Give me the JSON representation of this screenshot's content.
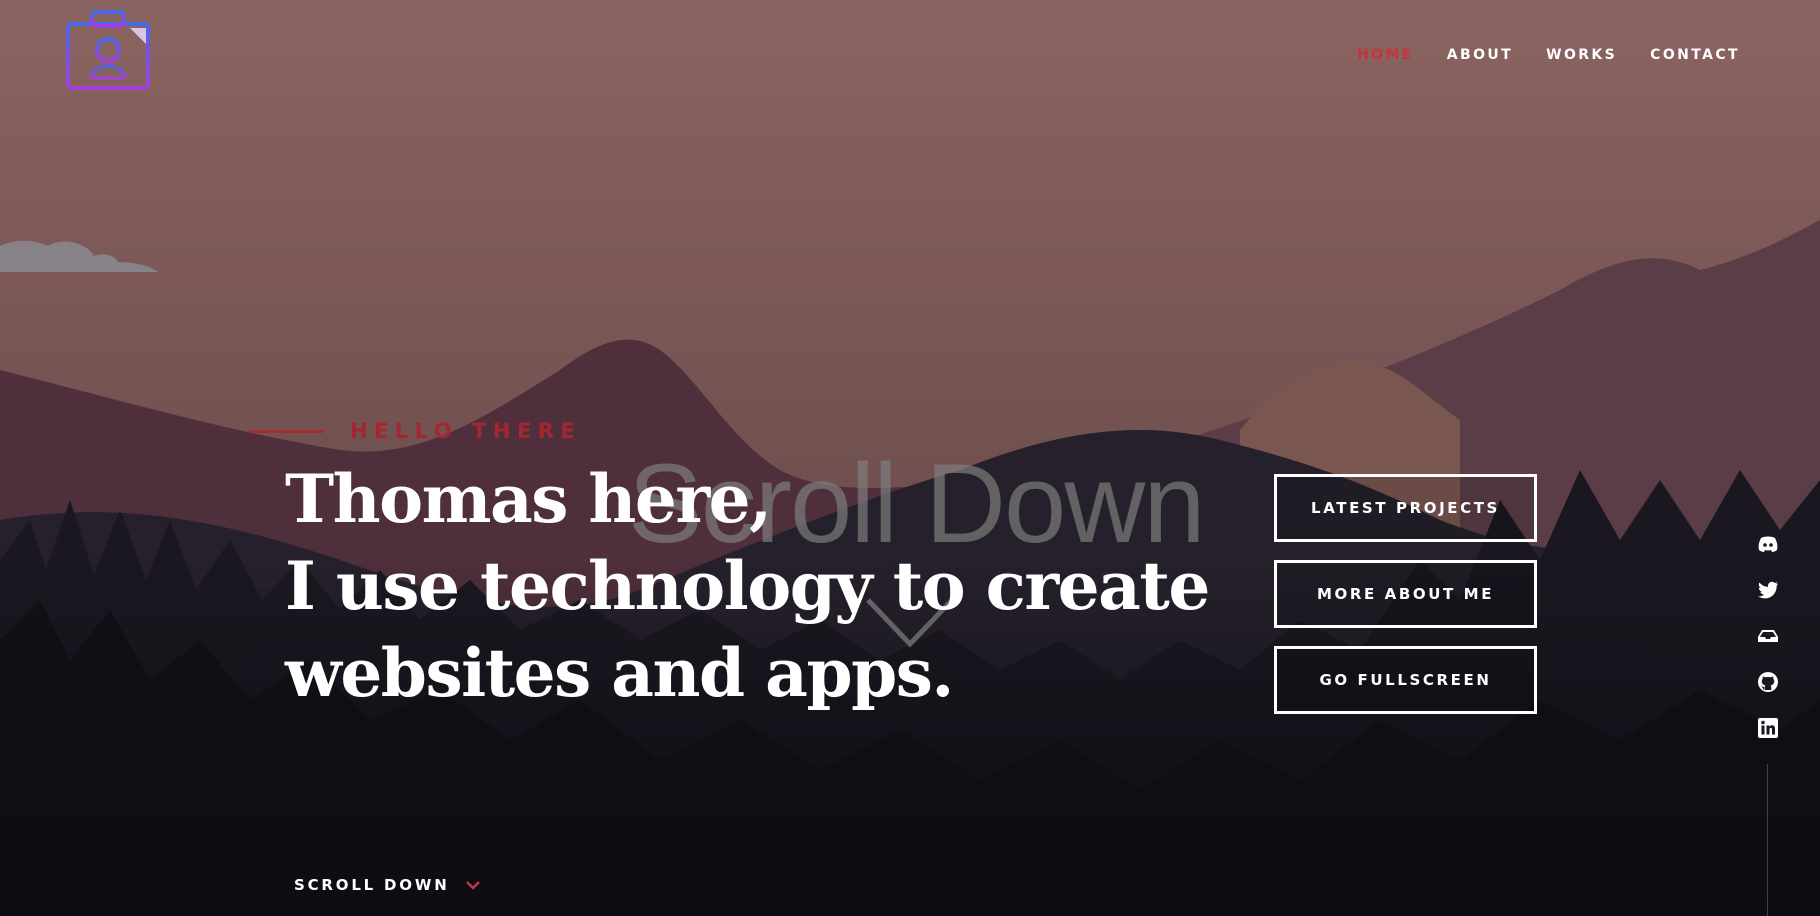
{
  "brand": {
    "logo_icon": "camera-portrait-icon"
  },
  "nav": {
    "items": [
      {
        "label": "HOME",
        "active": true
      },
      {
        "label": "ABOUT",
        "active": false
      },
      {
        "label": "WORKS",
        "active": false
      },
      {
        "label": "CONTACT",
        "active": false
      }
    ]
  },
  "hero": {
    "eyebrow": "HELLO THERE",
    "headline_lines": [
      "Thomas here,",
      "I use technology to create",
      "websites and apps."
    ],
    "overlay_text": "Scroll Down"
  },
  "actions": {
    "buttons": [
      {
        "label": "LATEST PROJECTS"
      },
      {
        "label": "MORE ABOUT ME"
      },
      {
        "label": "GO FULLSCREEN"
      }
    ]
  },
  "social": {
    "icons": [
      "discord-icon",
      "twitter-icon",
      "inbox-icon",
      "github-icon",
      "linkedin-icon"
    ]
  },
  "footer": {
    "scroll_label": "SCROLL DOWN"
  },
  "colors": {
    "accent": "#c7333f",
    "text": "#ffffff",
    "sky_top": "#8b6660",
    "forest": "#0e0d12"
  }
}
